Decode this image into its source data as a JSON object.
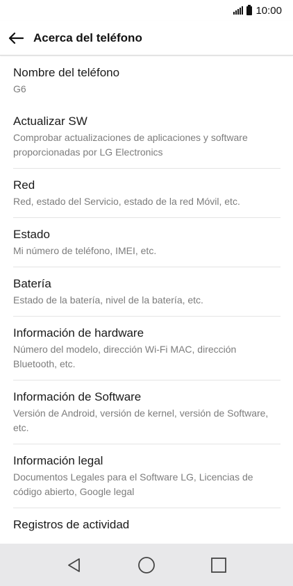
{
  "status_bar": {
    "time": "10:00"
  },
  "header": {
    "title": "Acerca del teléfono"
  },
  "settings": {
    "items": [
      {
        "title": "Nombre del teléfono",
        "subtitle": "G6"
      },
      {
        "title": "Actualizar SW",
        "subtitle": "Comprobar actualizaciones de aplicaciones y software proporcionadas por LG Electronics"
      },
      {
        "title": "Red",
        "subtitle": "Red, estado del Servicio, estado de la red Móvil, etc."
      },
      {
        "title": "Estado",
        "subtitle": "Mi número de teléfono, IMEI, etc."
      },
      {
        "title": "Batería",
        "subtitle": "Estado de la batería, nivel de la batería, etc."
      },
      {
        "title": "Información de hardware",
        "subtitle": "Número del modelo, dirección Wi-Fi MAC, dirección Bluetooth, etc."
      },
      {
        "title": "Información de Software",
        "subtitle": "Versión de Android, versión de kernel, versión de Software, etc."
      },
      {
        "title": "Información legal",
        "subtitle": "Documentos Legales para el Software LG, Licencias de código abierto, Google legal"
      },
      {
        "title": "Registros de actividad"
      }
    ]
  },
  "icons": {
    "back": "arrow-left-icon",
    "signal": "signal-icon",
    "battery": "battery-icon",
    "nav_back": "triangle-back-icon",
    "nav_home": "circle-home-icon",
    "nav_recents": "square-recents-icon"
  },
  "colors": {
    "text_primary": "#1a1a1a",
    "text_secondary": "#7c7c7c",
    "divider": "#e4e4e4",
    "nav_bar_bg": "#e8e8ea"
  }
}
